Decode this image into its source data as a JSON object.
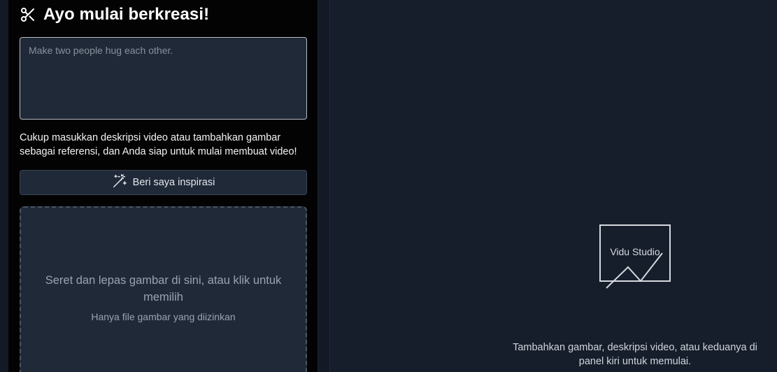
{
  "header": {
    "title": "Ayo mulai berkreasi!",
    "icon": "scissors-icon"
  },
  "prompt": {
    "value": "",
    "placeholder": "Make two people hug each other."
  },
  "helper_text": "Cukup masukkan deskripsi video atau tambahkan gambar sebagai referensi, dan Anda siap untuk mulai membuat video!",
  "inspire_button": {
    "label": "Beri saya inspirasi",
    "icon": "magic-wand-icon"
  },
  "dropzone": {
    "main_text": "Seret dan lepas gambar di sini, atau klik untuk memilih",
    "sub_text": "Hanya file gambar yang diizinkan"
  },
  "preview": {
    "label": "Vidu Studio",
    "icon": "image-placeholder-icon",
    "empty_hint": "Tambahkan gambar, deskripsi video, atau keduanya di panel kiri untuk memulai."
  },
  "colors": {
    "page_background": "#161e2c",
    "panel_background": "#030304",
    "field_background": "#1f2938",
    "text_primary": "#ffffff",
    "text_muted": "#9ca3af"
  }
}
